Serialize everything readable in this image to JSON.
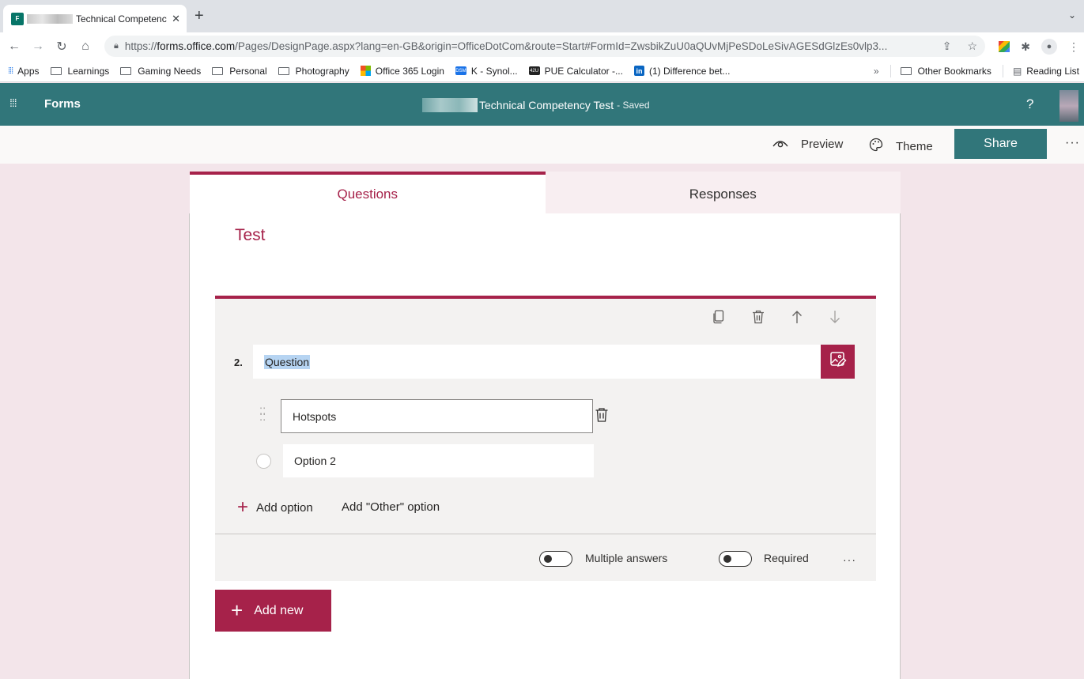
{
  "browser": {
    "tab_title": "Technical Competency Test",
    "tab_favicon_text": "F",
    "url_domain": "forms.office.com",
    "url_prefix": "https://",
    "url_rest": "/Pages/DesignPage.aspx?lang=en-GB&origin=OfficeDotCom&route=Start#FormId=ZwsbikZuU0aQUvMjPeSDoLeSivAGESdGlzEs0vlp3...",
    "bookmarks": [
      "Apps",
      "Learnings",
      "Gaming Needs",
      "Personal",
      "Photography",
      "Office 365 Login",
      "K          - Synol...",
      "PUE Calculator -...",
      "(1) Difference bet..."
    ],
    "bookmarks_right": [
      "Other Bookmarks",
      "Reading List"
    ],
    "bookmark_badges": {
      "synology": "DSM",
      "pue": "42U",
      "linkedin": "in"
    }
  },
  "app": {
    "name": "Forms",
    "form_title": "Technical Competency Test",
    "saved_status": "- Saved",
    "help_label": "?",
    "accent": "#a6224a",
    "header_color": "#31767a"
  },
  "commands": {
    "preview": "Preview",
    "theme": "Theme",
    "share": "Share",
    "more": "···"
  },
  "tabs": {
    "questions": "Questions",
    "responses": "Responses"
  },
  "form": {
    "name": "Test",
    "question": {
      "number": "2.",
      "title": "Question",
      "options": [
        "Hotspots",
        "Option 2"
      ],
      "add_option": "Add option",
      "add_other": "Add \"Other\" option",
      "multiple_answers_label": "Multiple answers",
      "multiple_answers": false,
      "required_label": "Required",
      "required": false
    },
    "add_new": "Add new"
  }
}
